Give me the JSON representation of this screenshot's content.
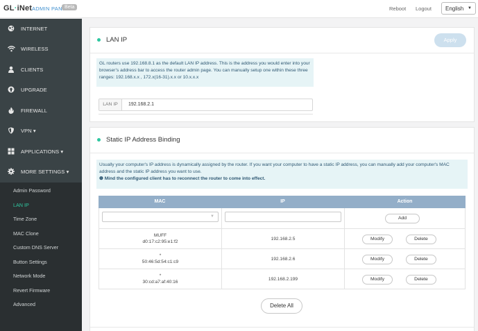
{
  "header": {
    "logo_text": "GL·iNet",
    "logo_left": "GL",
    "logo_dot": "·",
    "logo_right": "iNet",
    "title": "ADMIN PANEL",
    "beta_badge": "Beta",
    "reboot_label": "Reboot",
    "logout_label": "Logout",
    "language": "English"
  },
  "sidebar": {
    "items": [
      {
        "label": "INTERNET",
        "icon": "globe-icon"
      },
      {
        "label": "WIRELESS",
        "icon": "wifi-icon"
      },
      {
        "label": "CLIENTS",
        "icon": "user-icon"
      },
      {
        "label": "UPGRADE",
        "icon": "upload-icon"
      },
      {
        "label": "FIREWALL",
        "icon": "fire-icon"
      },
      {
        "label": "VPN ▾",
        "icon": "shield-icon"
      },
      {
        "label": "APPLICATIONS ▾",
        "icon": "grid-icon"
      },
      {
        "label": "MORE SETTINGS ▾",
        "icon": "gear-icon"
      }
    ],
    "sub_items": [
      {
        "label": "Admin Password"
      },
      {
        "label": "LAN IP"
      },
      {
        "label": "Time Zone"
      },
      {
        "label": "MAC Clone"
      },
      {
        "label": "Custom DNS Server"
      },
      {
        "label": "Button Settings"
      },
      {
        "label": "Network Mode"
      },
      {
        "label": "Revert Firmware"
      },
      {
        "label": "Advanced"
      }
    ],
    "active_sub": "LAN IP"
  },
  "lan_ip_panel": {
    "title": "LAN IP",
    "apply_label": "Apply",
    "info_text": "GL routers use 192.168.8.1 as the default LAN IP address. This is the address you would enter into your browser’s address bar to access the router admin page. You can manually setup one within these three ranges: 192.168.x.x , 172.x(16-31).x.x or 10.x.x.x",
    "field_label": "LAN IP",
    "field_value": "192.168.2.1"
  },
  "static_panel": {
    "title": "Static IP Address Binding",
    "info_text": "Usually your computer's IP address is dynamically assigned by the router. If you want your computer to have a static IP address, you can manually add your computer's MAC address and the static IP address you want to use.",
    "warning_text": "Mind the configured client has to reconnect the router to come into effect.",
    "columns": [
      "MAC",
      "IP",
      "Action"
    ],
    "add_label": "Add",
    "modify_label": "Modify",
    "delete_label": "Delete",
    "delete_all_label": "Delete All",
    "rows": [
      {
        "name": "MUFF",
        "mac": "d0:17:c2:95:e1:f2",
        "ip": "192.168.2.5"
      },
      {
        "name": "*",
        "mac": "50:46:5d:54:c1:c9",
        "ip": "192.168.2.6"
      },
      {
        "name": "*",
        "mac": "30:cd:a7:af:40:16",
        "ip": "192.168.2.199"
      }
    ]
  },
  "colors": {
    "accent": "#2fc7a0",
    "sidebar_bg": "#3a4346",
    "table_header": "#93aec8",
    "info_bg": "#e6f4f6"
  }
}
